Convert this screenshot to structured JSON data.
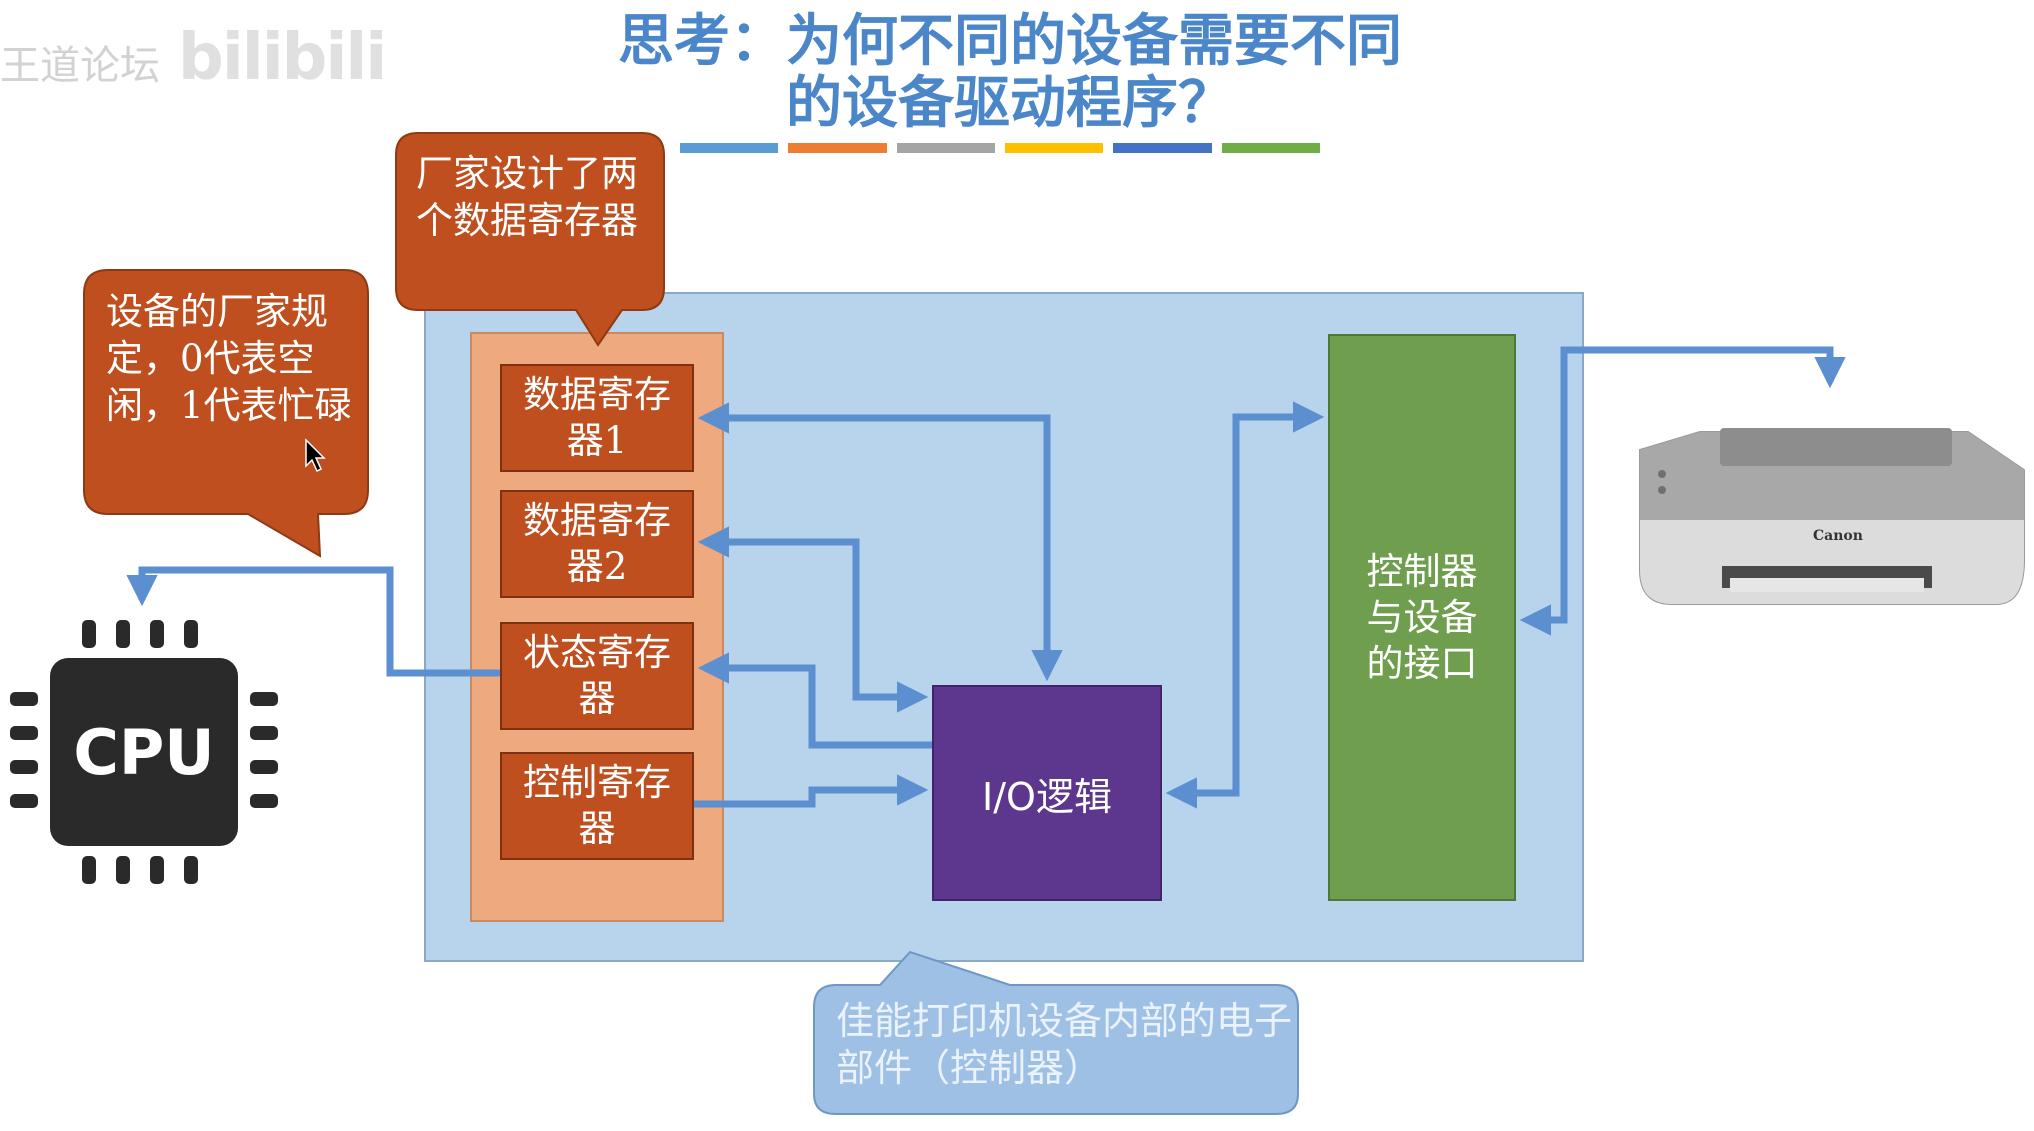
{
  "watermark": {
    "text": "王道论坛",
    "brand": "bilibili"
  },
  "title": {
    "line1": "思考：为何不同的设备需要不同",
    "line2": "的设备驱动程序？"
  },
  "title_bar_colors": [
    "#5b9bd5",
    "#ed7d31",
    "#a5a5a5",
    "#ffc000",
    "#4472c4",
    "#70ad47"
  ],
  "callouts": {
    "registers_note": "厂家设计了两个数据寄存器",
    "status_note": "设备的厂家规定，0代表空闲，1代表忙碌",
    "controller_note": "佳能打印机设备内部的电子部件（控制器）"
  },
  "registers": [
    {
      "label": "数据寄存器1"
    },
    {
      "label": "数据寄存器2"
    },
    {
      "label": "状态寄存器"
    },
    {
      "label": "控制寄存器"
    }
  ],
  "io_logic": {
    "label": "I/O逻辑"
  },
  "device_interface": {
    "label": "控制器与设备的接口"
  },
  "cpu": {
    "label": "CPU"
  },
  "printer": {
    "brand": "Canon"
  },
  "colors": {
    "controller_panel": "#b8d3ec",
    "register_group": "#efa97f",
    "register": "#bf4f1e",
    "io_logic": "#5c378d",
    "device_interface": "#6f9e4e",
    "arrow": "#5b8fd0",
    "title": "#4a86c8"
  }
}
